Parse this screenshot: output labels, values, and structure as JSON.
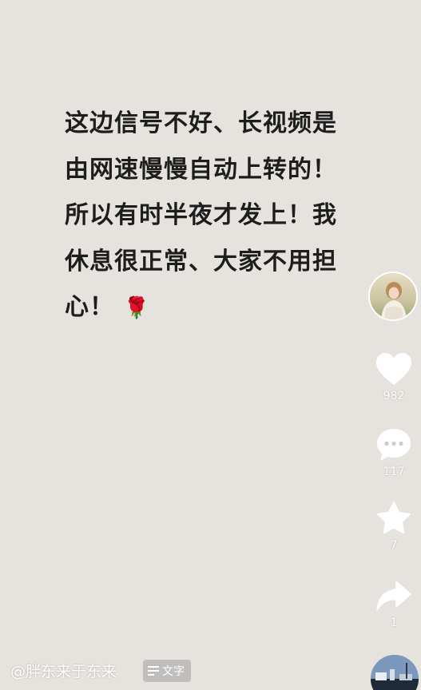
{
  "post": {
    "lines": [
      "这边信号不好、长视频是",
      "由网速慢慢自动上转的！",
      "所以有时半夜才发上！我",
      "休息很正常、大家不用担",
      "心！"
    ],
    "emoji": "🌹"
  },
  "sidebar": {
    "avatar_icon": "user-avatar",
    "like_count": "982",
    "comment_count": "117",
    "favorite_count": "7",
    "share_count": "1"
  },
  "footer": {
    "author": "@胖东来于东来",
    "text_tag_label": "文字",
    "text_tag_icon": "text-lines-icon"
  },
  "colors": {
    "background": "#e6e3de",
    "text": "#1d1d1d",
    "overlay_white": "#ffffff"
  }
}
